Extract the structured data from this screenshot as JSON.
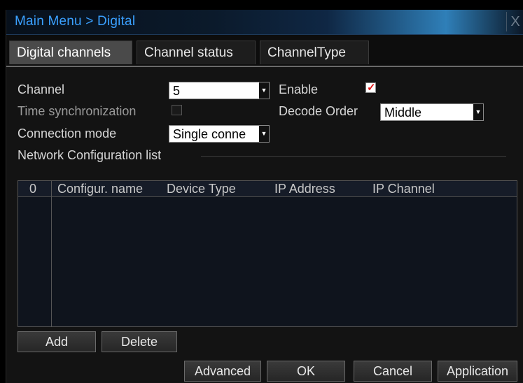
{
  "window": {
    "title": "Main Menu > Digital",
    "close_label": "X"
  },
  "tabs": [
    {
      "label": "Digital channels",
      "active": true
    },
    {
      "label": "Channel status",
      "active": false
    },
    {
      "label": "ChannelType",
      "active": false
    }
  ],
  "form": {
    "channel_label": "Channel",
    "channel_value": "5",
    "enable_label": "Enable",
    "enable_checked": true,
    "time_sync_label": "Time synchronization",
    "time_sync_checked": false,
    "decode_order_label": "Decode Order",
    "decode_order_value": "Middle",
    "connection_mode_label": "Connection mode",
    "connection_mode_value": "Single conne",
    "network_list_label": "Network Configuration list"
  },
  "table": {
    "columns": [
      "0",
      "Configur. name",
      "Device Type",
      "IP Address",
      "IP Channel"
    ],
    "rows": []
  },
  "buttons": {
    "add": "Add",
    "delete": "Delete",
    "advanced": "Advanced",
    "ok": "OK",
    "cancel": "Cancel",
    "application": "Application"
  },
  "colors": {
    "title_text": "#3aa0ff",
    "check_mark": "#e01818"
  }
}
